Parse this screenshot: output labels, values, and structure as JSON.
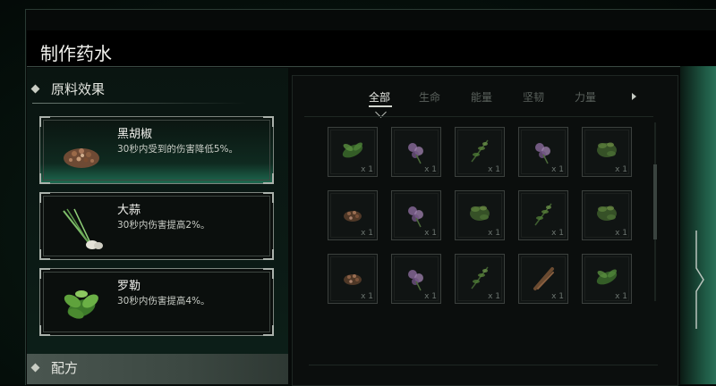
{
  "window": {
    "title": "制作药水"
  },
  "left": {
    "section_effects": "原料效果",
    "section_recipe": "配方",
    "ingredients": [
      {
        "name": "黑胡椒",
        "desc": "30秒内受到的伤害降低5%。",
        "icon": "pepper-icon",
        "selected": true
      },
      {
        "name": "大蒜",
        "desc": "30秒内伤害提高2%。",
        "icon": "garlic-icon",
        "selected": false
      },
      {
        "name": "罗勒",
        "desc": "30秒内伤害提高4%。",
        "icon": "basil-icon",
        "selected": false
      }
    ]
  },
  "right": {
    "tabs": [
      {
        "label": "全部",
        "active": true
      },
      {
        "label": "生命",
        "active": false
      },
      {
        "label": "能量",
        "active": false
      },
      {
        "label": "坚韧",
        "active": false
      },
      {
        "label": "力量",
        "active": false
      }
    ],
    "slots": [
      {
        "icon": "green-herb-icon",
        "count": "x 1"
      },
      {
        "icon": "purple-flower-icon",
        "count": "x 1"
      },
      {
        "icon": "sprig-icon",
        "count": "x 1"
      },
      {
        "icon": "purple-flower-icon",
        "count": "x 1"
      },
      {
        "icon": "leafy-herb-icon",
        "count": "x 1"
      },
      {
        "icon": "pepper-icon",
        "count": "x 1"
      },
      {
        "icon": "purple-flower-icon",
        "count": "x 1"
      },
      {
        "icon": "leafy-herb-icon",
        "count": "x 1"
      },
      {
        "icon": "sprig-icon",
        "count": "x 1"
      },
      {
        "icon": "leafy-herb-icon",
        "count": "x 1"
      },
      {
        "icon": "pepper-icon",
        "count": "x 1"
      },
      {
        "icon": "purple-flower-icon",
        "count": "x 1"
      },
      {
        "icon": "sprig-icon",
        "count": "x 1"
      },
      {
        "icon": "root-icon",
        "count": "x 1"
      },
      {
        "icon": "green-herb-icon",
        "count": "x 1"
      }
    ]
  },
  "colors": {
    "accent_green": "#1e6a50",
    "border": "#7d857f"
  }
}
